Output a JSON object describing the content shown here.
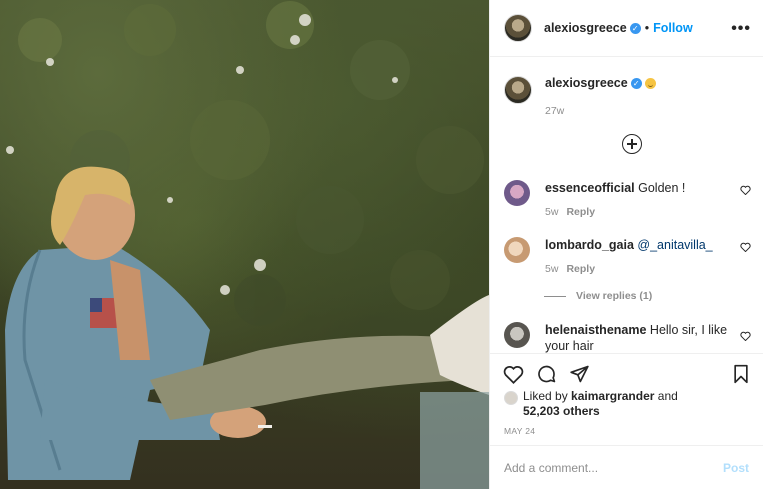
{
  "post": {
    "username": "alexiosgreece",
    "follow_label": "Follow",
    "more_label": "•••",
    "caption_time": "27w",
    "likes_prefix": "Liked by",
    "likes_user": "kaimargrander",
    "likes_and": "and",
    "likes_others": "52,203 others",
    "date": "MAY 24",
    "add_comment_placeholder": "Add a comment...",
    "post_label": "Post"
  },
  "comments": [
    {
      "user": "essenceofficial",
      "text": "Golden !",
      "time": "5w",
      "reply_label": "Reply"
    },
    {
      "user": "lombardo_gaia",
      "mention": "@_anitavilla_",
      "time": "5w",
      "reply_label": "Reply"
    },
    {
      "user": "helenaisthename",
      "text": "Hello sir, I like your hair"
    }
  ],
  "view_replies_label": "View replies (1)",
  "colors": {
    "link_blue": "#0095f6",
    "verified_blue": "#3897f0",
    "muted": "#8e8e8e",
    "post_disabled": "#b2dffc"
  }
}
